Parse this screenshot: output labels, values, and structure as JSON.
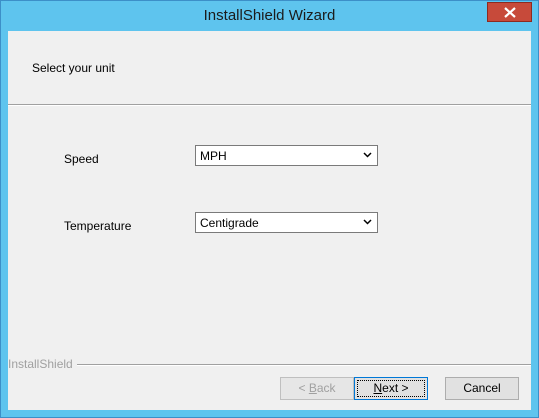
{
  "window": {
    "title": "InstallShield Wizard"
  },
  "header": {
    "text": "Select your unit"
  },
  "form": {
    "speed_label": "Speed",
    "speed_value": "MPH",
    "temperature_label": "Temperature",
    "temperature_value": "Centigrade"
  },
  "footer": {
    "brand": "InstallShield",
    "back_mnemonic": "B",
    "back_rest": "ack",
    "back_prefix": "< ",
    "next_mnemonic": "N",
    "next_rest": "ext >",
    "cancel_label": "Cancel"
  },
  "colors": {
    "titlebar": "#5ec4ee",
    "close_button": "#c74a3a",
    "client_bg": "#f0f0f0"
  },
  "icons": {
    "close": "close-icon",
    "dropdown": "chevron-down-icon"
  }
}
